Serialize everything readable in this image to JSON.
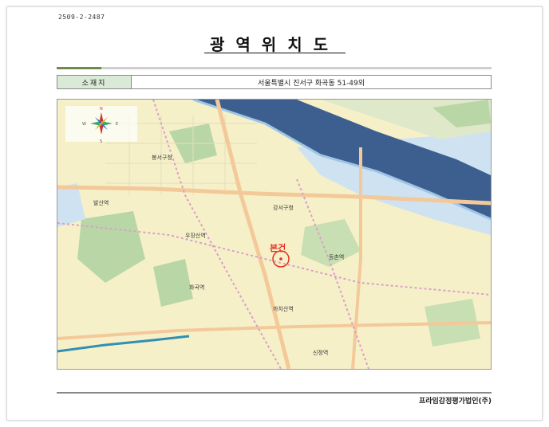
{
  "document": {
    "code": "2509-2-2487",
    "title": "광역위치도",
    "location_label": "소재지",
    "location_value": "서울특별시 진서구 화곡동 51-49외",
    "company": "프라임감정평가법인(주)"
  },
  "map": {
    "target_label": "본건",
    "compass_marks": {
      "north": "N",
      "south": "S",
      "west": "W",
      "east": "E"
    },
    "place_labels": {
      "l1": "봉서구청",
      "l2": "우장산역",
      "l3": "화곡역",
      "l4": "까치산역",
      "l5": "강서구청",
      "l6": "발산역",
      "l7": "등촌역",
      "l8": "신정역"
    },
    "colors": {
      "river": "#3d5f8f",
      "river_edge": "#9fc6e6",
      "land": "#f6f0c8",
      "park": "#b9d7a6",
      "main_road": "#f3c99a",
      "rail": "#d9a0c8",
      "target": "#e53323"
    }
  }
}
